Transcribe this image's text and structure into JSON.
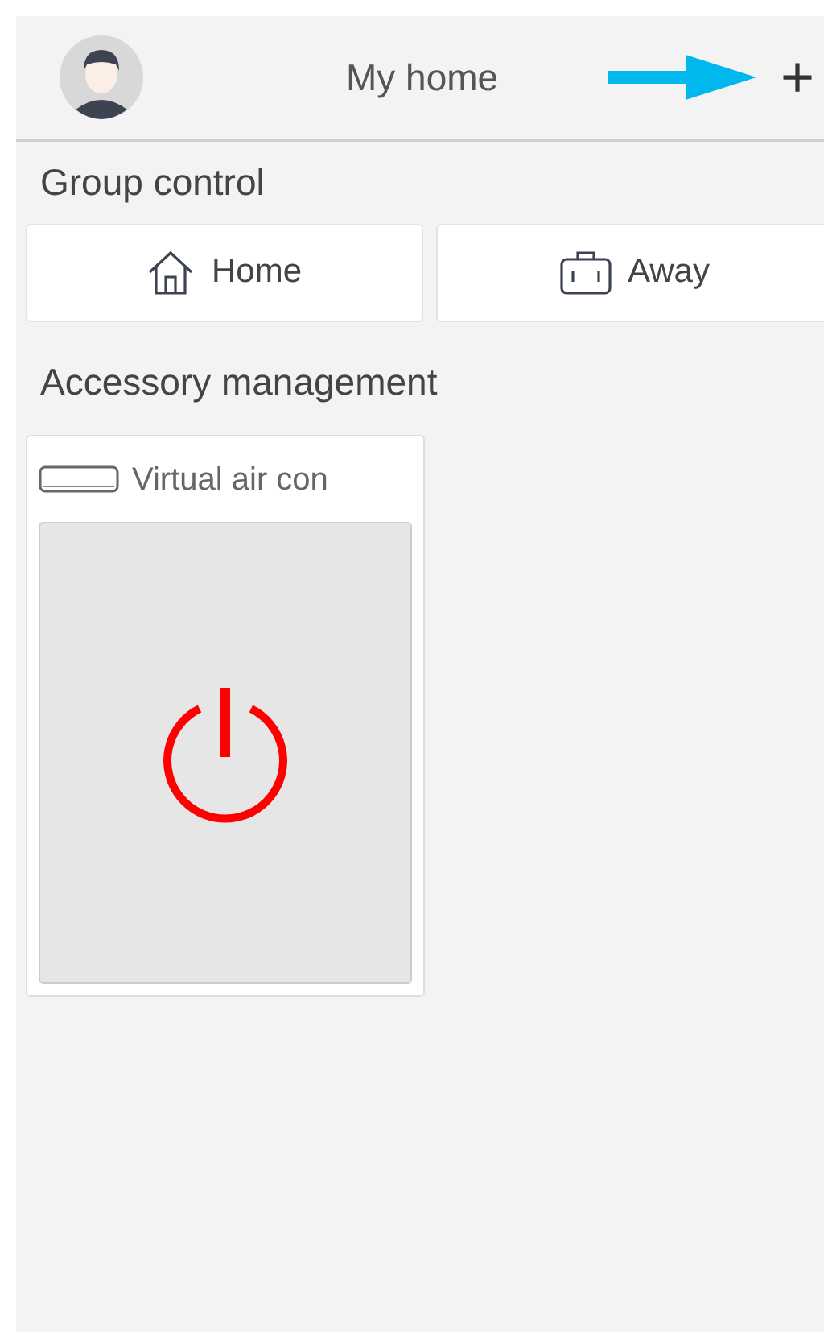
{
  "header": {
    "title": "My home",
    "add": "+"
  },
  "group_control": {
    "heading": "Group control",
    "buttons": [
      {
        "label": "Home",
        "kind": "home"
      },
      {
        "label": "Away",
        "kind": "away"
      }
    ]
  },
  "accessories": {
    "heading": "Accessory management",
    "devices": [
      {
        "name": "Virtual air con",
        "kind": "aircon",
        "on": false
      }
    ]
  }
}
